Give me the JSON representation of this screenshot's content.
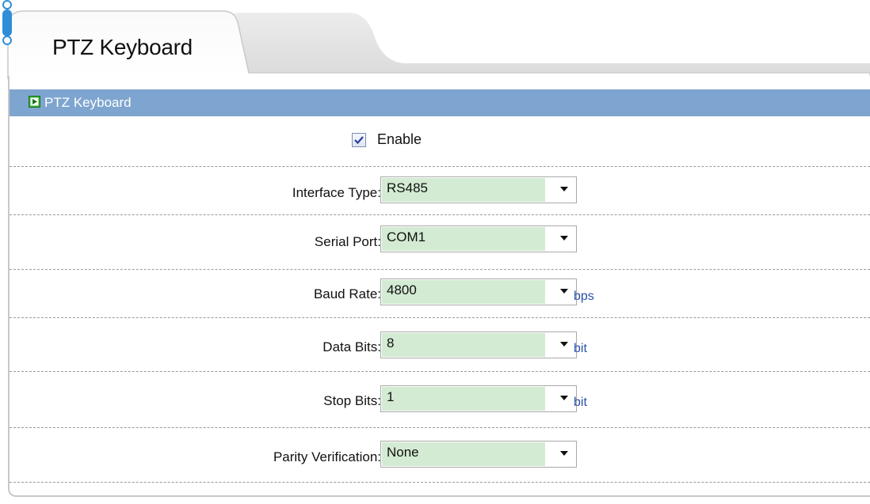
{
  "tab": {
    "title": "PTZ Keyboard"
  },
  "section": {
    "title": "PTZ Keyboard",
    "icon": "play-arrow-icon",
    "header_color": "#7ea5cf"
  },
  "enable": {
    "label": "Enable",
    "checked": true
  },
  "fields": {
    "interface_type": {
      "label": "Interface Type:",
      "value": "RS485",
      "unit": ""
    },
    "serial_port": {
      "label": "Serial Port:",
      "value": "COM1",
      "unit": ""
    },
    "baud_rate": {
      "label": "Baud Rate:",
      "value": "4800",
      "unit": "bps"
    },
    "data_bits": {
      "label": "Data Bits:",
      "value": "8",
      "unit": "bit"
    },
    "stop_bits": {
      "label": "Stop Bits:",
      "value": "1",
      "unit": "bit"
    },
    "parity": {
      "label": "Parity Verification:",
      "value": "None",
      "unit": ""
    }
  },
  "colors": {
    "select_fill": "#d3ebd3",
    "unit_text": "#2a4fa8",
    "tab_indicator": "#2f8fd6"
  }
}
